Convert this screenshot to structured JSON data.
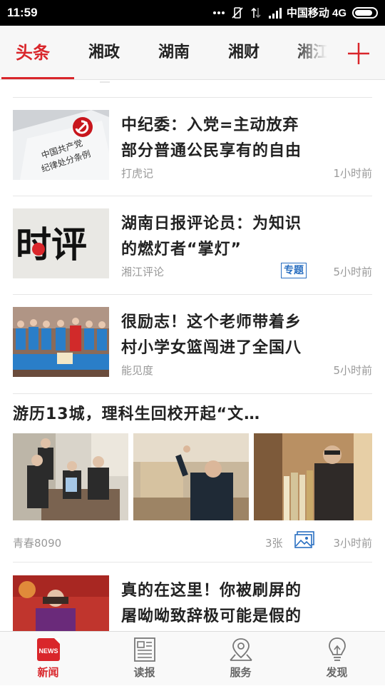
{
  "status_bar": {
    "time": "11:59",
    "carrier": "中国移动 4G"
  },
  "channels": {
    "tabs": [
      "头条",
      "湘政",
      "湖南",
      "湘财",
      "湘江"
    ],
    "active_index": 0,
    "add_icon": "plus-icon"
  },
  "feed": {
    "items": [
      {
        "title": "中纪委：入党=主动放弃部分普通公民享有的自由",
        "title_lines": [
          "中纪委：入党=主动放弃",
          "部分普通公民享有的自由"
        ],
        "source": "打虎记",
        "time": "1小时前",
        "thumb_text": "中国共产党纪律处分条例"
      },
      {
        "title": "湖南日报评论员：为知识的燃灯者“掌灯”",
        "title_lines": [
          "湖南日报评论员：为知识",
          "的燃灯者“掌灯”"
        ],
        "source": "湘江评论",
        "badge": "专题",
        "time": "5小时前",
        "thumb_text": "时评"
      },
      {
        "title": "很励志！这个老师带着乡村小学女篮闯进了全国八",
        "title_lines": [
          "很励志！这个老师带着乡",
          "村小学女篮闯进了全国八"
        ],
        "source": "能见度",
        "time": "5小时前"
      }
    ],
    "gallery": {
      "title": "游历13城，理科生回校开起“文…",
      "source": "青春8090",
      "photo_count": "3张",
      "photo_icon": "image-icon",
      "time": "3小时前"
    },
    "last_item": {
      "title_lines": [
        "真的在这里！你被刷屏的",
        "屠呦呦致辞极可能是假的"
      ]
    }
  },
  "bottom_nav": {
    "items": [
      {
        "label": "新闻",
        "icon": "news-icon",
        "icon_text": "NEWS"
      },
      {
        "label": "读报",
        "icon": "newspaper-icon"
      },
      {
        "label": "服务",
        "icon": "location-icon"
      },
      {
        "label": "发现",
        "icon": "lightbulb-icon"
      }
    ],
    "active_index": 0
  },
  "colors": {
    "accent": "#d9262b",
    "badge_blue": "#2a6fc1",
    "text_primary": "#222222",
    "text_secondary": "#999999"
  }
}
